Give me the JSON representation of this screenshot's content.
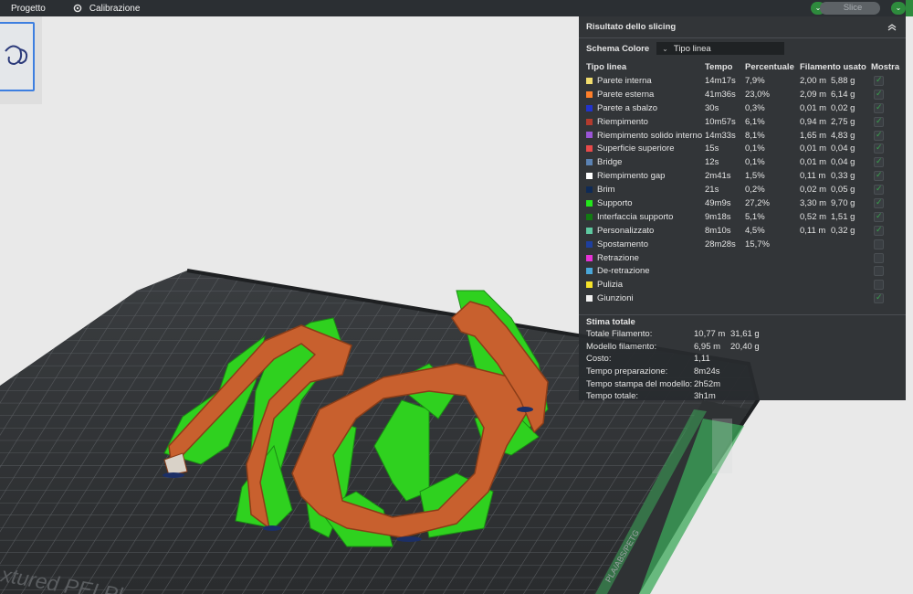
{
  "topbar": {
    "project_label": "Progetto",
    "calibration_label": "Calibrazione",
    "slice_label": "Slice"
  },
  "panel": {
    "title": "Risultato dello slicing",
    "scheme_label": "Schema Colore",
    "scheme_value": "Tipo linea",
    "headers": [
      "Tipo linea",
      "Tempo",
      "Percentuale",
      "Filamento usato",
      "Mostra"
    ],
    "rows": [
      {
        "name": "Parete interna",
        "color": "#f2dd6e",
        "time": "14m17s",
        "pct": "7,9%",
        "len": "2,00 m",
        "wt": "5,88 g",
        "show": true
      },
      {
        "name": "Parete esterna",
        "color": "#ff7f2a",
        "time": "41m36s",
        "pct": "23,0%",
        "len": "2,09 m",
        "wt": "6,14 g",
        "show": true
      },
      {
        "name": "Parete a sbalzo",
        "color": "#2233cc",
        "time": "30s",
        "pct": "0,3%",
        "len": "0,01 m",
        "wt": "0,02 g",
        "show": true
      },
      {
        "name": "Riempimento",
        "color": "#b33b2e",
        "time": "10m57s",
        "pct": "6,1%",
        "len": "0,94 m",
        "wt": "2,75 g",
        "show": true
      },
      {
        "name": "Riempimento solido interno",
        "color": "#9a55d6",
        "time": "14m33s",
        "pct": "8,1%",
        "len": "1,65 m",
        "wt": "4,83 g",
        "show": true
      },
      {
        "name": "Superficie superiore",
        "color": "#e84a4a",
        "time": "15s",
        "pct": "0,1%",
        "len": "0,01 m",
        "wt": "0,04 g",
        "show": true
      },
      {
        "name": "Bridge",
        "color": "#5b82b3",
        "time": "12s",
        "pct": "0,1%",
        "len": "0,01 m",
        "wt": "0,04 g",
        "show": true
      },
      {
        "name": "Riempimento gap",
        "color": "#ffffff",
        "time": "2m41s",
        "pct": "1,5%",
        "len": "0,11 m",
        "wt": "0,33 g",
        "show": true
      },
      {
        "name": "Brim",
        "color": "#0f2a55",
        "time": "21s",
        "pct": "0,2%",
        "len": "0,02 m",
        "wt": "0,05 g",
        "show": true
      },
      {
        "name": "Supporto",
        "color": "#23e61b",
        "time": "49m9s",
        "pct": "27,2%",
        "len": "3,30 m",
        "wt": "9,70 g",
        "show": true
      },
      {
        "name": "Interfaccia supporto",
        "color": "#127a12",
        "time": "9m18s",
        "pct": "5,1%",
        "len": "0,52 m",
        "wt": "1,51 g",
        "show": true
      },
      {
        "name": "Personalizzato",
        "color": "#5ec9a0",
        "time": "8m10s",
        "pct": "4,5%",
        "len": "0,11 m",
        "wt": "0,32 g",
        "show": true
      },
      {
        "name": "Spostamento",
        "color": "#1e3f9e",
        "time": "28m28s",
        "pct": "15,7%",
        "len": "",
        "wt": "",
        "show": false
      },
      {
        "name": "Retrazione",
        "color": "#e633d6",
        "time": "",
        "pct": "",
        "len": "",
        "wt": "",
        "show": false
      },
      {
        "name": "De-retrazione",
        "color": "#4aa7d9",
        "time": "",
        "pct": "",
        "len": "",
        "wt": "",
        "show": false
      },
      {
        "name": "Pulizia",
        "color": "#f5e22a",
        "time": "",
        "pct": "",
        "len": "",
        "wt": "",
        "show": false
      },
      {
        "name": "Giunzioni",
        "color": "#f0f0f0",
        "time": "",
        "pct": "",
        "len": "",
        "wt": "",
        "show": true
      }
    ],
    "total_title": "Stima totale",
    "totals": [
      {
        "label": "Totale Filamento:",
        "v1": "10,77 m",
        "v2": "31,61 g"
      },
      {
        "label": "Modello filamento:",
        "v1": "6,95 m",
        "v2": "20,40 g"
      },
      {
        "label": "Costo:",
        "v1": "1,11",
        "v2": ""
      },
      {
        "label": "Tempo preparazione:",
        "v1": "8m24s",
        "v2": ""
      },
      {
        "label": "Tempo stampa del modello:",
        "v1": "2h52m",
        "v2": ""
      },
      {
        "label": "Tempo totale:",
        "v1": "3h1m",
        "v2": ""
      }
    ]
  },
  "plate": {
    "text_big": "xtured PEI Pl",
    "text_small": "PLA/ABS/PETG"
  }
}
